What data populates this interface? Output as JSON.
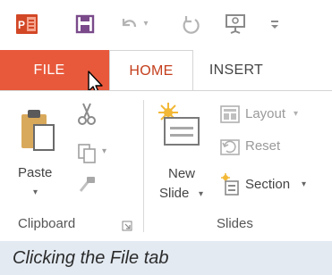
{
  "quick_access": {
    "app_icon": "powerpoint-icon",
    "items": [
      "save-icon",
      "undo-icon",
      "redo-icon",
      "slideshow-icon",
      "customize-icon"
    ]
  },
  "tabs": [
    {
      "label": "FILE",
      "state": "hovered"
    },
    {
      "label": "HOME",
      "state": "selected"
    },
    {
      "label": "INSERT",
      "state": "normal"
    }
  ],
  "clipboard": {
    "paste_label": "Paste",
    "group_label": "Clipboard"
  },
  "slides": {
    "new_slide_line1": "New",
    "new_slide_line2": "Slide",
    "layout_label": "Layout",
    "reset_label": "Reset",
    "section_label": "Section",
    "group_label": "Slides"
  },
  "caption": "Clicking the File tab",
  "colors": {
    "file_tab": "#e8593b",
    "home_tab_text": "#c43e1c",
    "caption_bg": "#e3eaf2",
    "icon_orange": "#d24726",
    "icon_purple": "#7a4a8a"
  }
}
